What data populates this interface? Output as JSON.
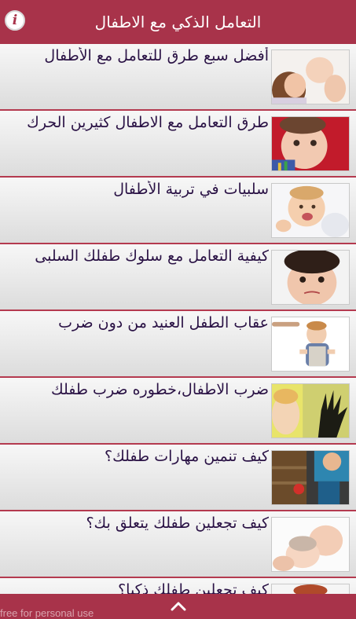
{
  "header": {
    "title": "التعامل الذكي مع الاطفال",
    "info_icon": "info-icon"
  },
  "articles": [
    {
      "title": "أفضل سبع طرق للتعامل مع الأطفال",
      "thumb": "mother-kissing-baby"
    },
    {
      "title": "طرق التعامل مع الاطفال كثيرين الحرك",
      "thumb": "baby-face"
    },
    {
      "title": "سلبيات في تربية الأطفال",
      "thumb": "laughing-baby"
    },
    {
      "title": "كيفية التعامل مع سلوك طفلك السلبى",
      "thumb": "sad-child"
    },
    {
      "title": "عقاب الطفل العنيد من دون ضرب",
      "thumb": "child-scolded"
    },
    {
      "title": "ضرب الاطفال،خطوره ضرب طفلك",
      "thumb": "hand-shadow"
    },
    {
      "title": "كيف تنمين مهارات طفلك؟",
      "thumb": "child-playing"
    },
    {
      "title": "كيف تجعلين طفلك يتعلق بك؟",
      "thumb": "mother-hugging-baby"
    },
    {
      "title": "كيف تجعلين طفلك ذكيا؟",
      "thumb": "baby"
    }
  ],
  "footer": {
    "scroll_up_icon": "chevron-up-icon",
    "watermark": "free for personal use"
  },
  "colors": {
    "accent": "#a8334a",
    "title_text": "#2a1245"
  }
}
